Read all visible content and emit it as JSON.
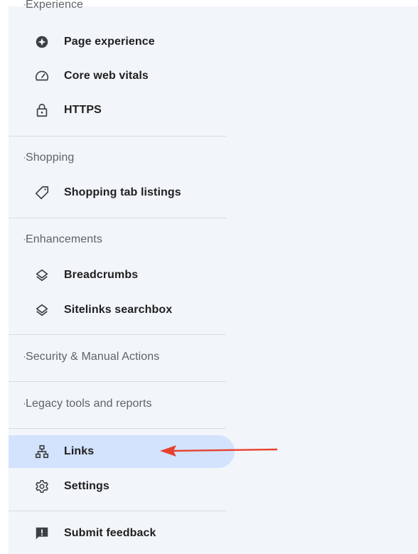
{
  "sections": {
    "experience": {
      "label": "Experience",
      "items": [
        {
          "label": "Page experience",
          "icon": "page-experience-icon"
        },
        {
          "label": "Core web vitals",
          "icon": "gauge-icon"
        },
        {
          "label": "HTTPS",
          "icon": "lock-icon"
        }
      ]
    },
    "shopping": {
      "label": "Shopping",
      "items": [
        {
          "label": "Shopping tab listings",
          "icon": "tag-icon"
        }
      ]
    },
    "enhancements": {
      "label": "Enhancements",
      "items": [
        {
          "label": "Breadcrumbs",
          "icon": "layers-icon"
        },
        {
          "label": "Sitelinks searchbox",
          "icon": "layers-icon"
        }
      ]
    },
    "security": {
      "label": "Security & Manual Actions"
    },
    "legacy": {
      "label": "Legacy tools and reports"
    }
  },
  "bottom_items": [
    {
      "label": "Links",
      "icon": "sitemap-icon",
      "active": true
    },
    {
      "label": "Settings",
      "icon": "gear-icon"
    },
    {
      "label": "Submit feedback",
      "icon": "feedback-icon"
    }
  ],
  "colors": {
    "sidebar_bg": "#f2f5fa",
    "active_bg": "#d3e3fd",
    "annotation_arrow": "#e8412f"
  }
}
